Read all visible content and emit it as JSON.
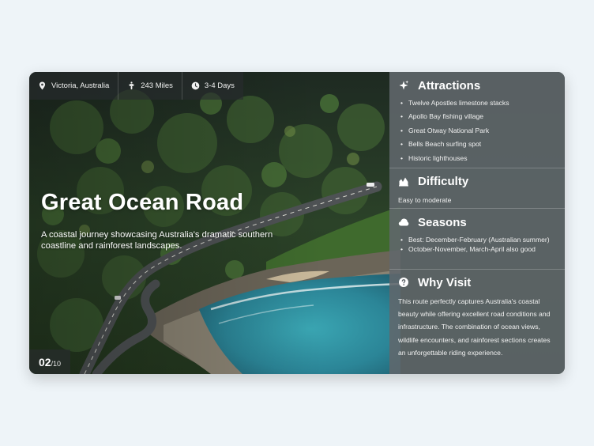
{
  "meta": [
    {
      "icon": "location-pin-icon",
      "label": "Victoria, Australia"
    },
    {
      "icon": "motorcycle-icon",
      "label": "243 Miles"
    },
    {
      "icon": "clock-icon",
      "label": "3-4 Days"
    }
  ],
  "hero": {
    "title": "Great Ocean Road",
    "description": "A coastal journey showcasing Australia's dramatic southern coastline and rainforest landscapes."
  },
  "slide": {
    "current": "02",
    "total": "/10"
  },
  "panel": {
    "attractions": {
      "title": "Attractions",
      "icon": "sparkle-icon",
      "items": [
        "Twelve Apostles limestone stacks",
        "Apollo Bay fishing village",
        "Great Otway National Park",
        "Bells Beach surfing spot",
        "Historic lighthouses"
      ]
    },
    "difficulty": {
      "title": "Difficulty",
      "icon": "mountain-chart-icon",
      "text": "Easy to moderate"
    },
    "seasons": {
      "title": "Seasons",
      "icon": "cloud-icon",
      "items": [
        "Best: December-February (Australian summer)",
        "October-November, March-April also good"
      ]
    },
    "why_visit": {
      "title": "Why Visit",
      "icon": "question-circle-icon",
      "text": "This route perfectly captures Australia's coastal beauty while offering excellent road conditions and infrastructure. The combination of ocean views, wildlife encounters, and rainforest sections creates an unforgettable riding experience."
    }
  },
  "colors": {
    "page_background": "#eef4f8",
    "panel_overlay": "#5c6266",
    "forest": "#2c4a2a",
    "sea": "#2f8ea0",
    "road": "#5a5e60"
  }
}
